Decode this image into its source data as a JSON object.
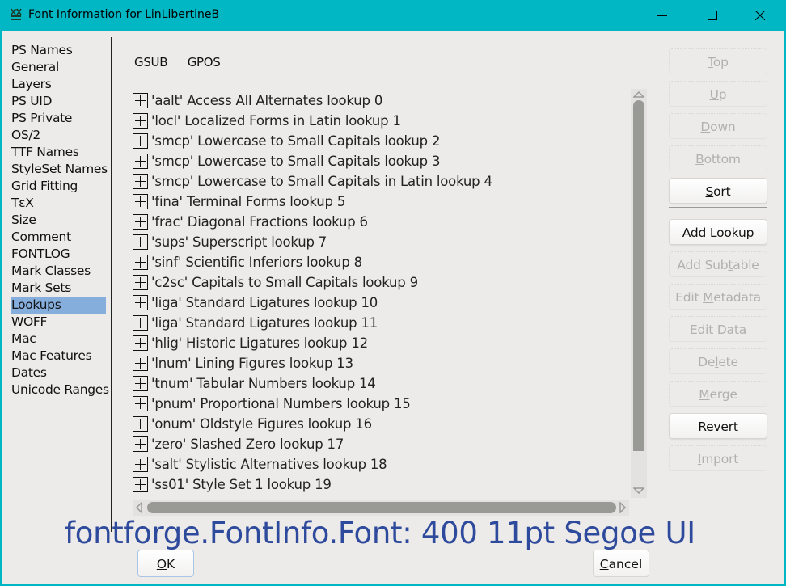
{
  "window": {
    "title": "Font Information for LinLibertineB",
    "controls": {
      "minimize": "minimize-icon",
      "maximize": "maximize-icon",
      "close": "close-icon"
    }
  },
  "sidebar": {
    "selected": "Lookups",
    "items": [
      {
        "label": "PS Names"
      },
      {
        "label": "General"
      },
      {
        "label": "Layers"
      },
      {
        "label": "PS UID"
      },
      {
        "label": "PS Private"
      },
      {
        "label": "OS/2"
      },
      {
        "label": "TTF Names"
      },
      {
        "label": "StyleSet Names"
      },
      {
        "label": "Grid Fitting"
      },
      {
        "label": "TεX"
      },
      {
        "label": "Size"
      },
      {
        "label": "Comment"
      },
      {
        "label": "FONTLOG"
      },
      {
        "label": "Mark Classes"
      },
      {
        "label": "Mark Sets"
      },
      {
        "label": "Lookups"
      },
      {
        "label": "WOFF"
      },
      {
        "label": "Mac"
      },
      {
        "label": "Mac Features"
      },
      {
        "label": "Dates"
      },
      {
        "label": "Unicode Ranges"
      }
    ]
  },
  "tabs": [
    {
      "label": "GSUB"
    },
    {
      "label": "GPOS"
    }
  ],
  "lookups": [
    {
      "label": "'aalt' Access All Alternates lookup 0"
    },
    {
      "label": "'locl' Localized Forms in Latin lookup 1"
    },
    {
      "label": "'smcp' Lowercase to Small Capitals lookup 2"
    },
    {
      "label": "'smcp' Lowercase to Small Capitals lookup 3"
    },
    {
      "label": "'smcp' Lowercase to Small Capitals in Latin lookup 4"
    },
    {
      "label": "'fina' Terminal Forms lookup 5"
    },
    {
      "label": "'frac' Diagonal Fractions lookup 6"
    },
    {
      "label": "'sups' Superscript lookup 7"
    },
    {
      "label": "'sinf' Scientific Inferiors lookup 8"
    },
    {
      "label": "'c2sc' Capitals to Small Capitals lookup 9"
    },
    {
      "label": "'liga' Standard Ligatures lookup 10"
    },
    {
      "label": "'liga' Standard Ligatures lookup 11"
    },
    {
      "label": "'hlig' Historic Ligatures lookup 12"
    },
    {
      "label": "'lnum' Lining Figures lookup 13"
    },
    {
      "label": "'tnum' Tabular Numbers lookup 14"
    },
    {
      "label": "'pnum' Proportional Numbers lookup 15"
    },
    {
      "label": "'onum' Oldstyle Figures lookup 16"
    },
    {
      "label": "'zero' Slashed Zero lookup 17"
    },
    {
      "label": "'salt' Stylistic Alternatives lookup 18"
    },
    {
      "label": "'ss01' Style Set 1 lookup 19"
    }
  ],
  "buttons": {
    "top": {
      "pre": "",
      "key": "T",
      "post": "op",
      "enabled": false
    },
    "up": {
      "pre": "",
      "key": "U",
      "post": "p",
      "enabled": false
    },
    "down": {
      "pre": "",
      "key": "D",
      "post": "own",
      "enabled": false
    },
    "bottom": {
      "pre": "",
      "key": "B",
      "post": "ottom",
      "enabled": false
    },
    "sort": {
      "pre": "",
      "key": "S",
      "post": "ort",
      "enabled": true
    },
    "add_lookup": {
      "pre": "Add ",
      "key": "L",
      "post": "ookup",
      "enabled": true
    },
    "add_subtable": {
      "pre": "Add Sub",
      "key": "t",
      "post": "able",
      "enabled": false
    },
    "edit_metadata": {
      "pre": "Edit ",
      "key": "M",
      "post": "etadata",
      "enabled": false
    },
    "edit_data": {
      "pre": "",
      "key": "E",
      "post": "dit Data",
      "enabled": false
    },
    "delete": {
      "pre": "De",
      "key": "l",
      "post": "ete",
      "enabled": false
    },
    "merge": {
      "pre": "",
      "key": "M",
      "post": "erge",
      "enabled": false
    },
    "revert": {
      "pre": "",
      "key": "R",
      "post": "evert",
      "enabled": true
    },
    "import": {
      "pre": "",
      "key": "I",
      "post": "mport",
      "enabled": false
    }
  },
  "footer": {
    "ok": {
      "key": "O",
      "post": "K"
    },
    "cancel": {
      "key": "C",
      "post": "ancel"
    }
  },
  "overlay_text": "fontforge.FontInfo.Font: 400 11pt Segoe UI",
  "colors": {
    "titlebar": "#00b7c3",
    "client_bg": "#edebe9",
    "selection": "#86aedd",
    "overlay_text": "#2e4a9c",
    "scroll_thumb": "#999996"
  }
}
